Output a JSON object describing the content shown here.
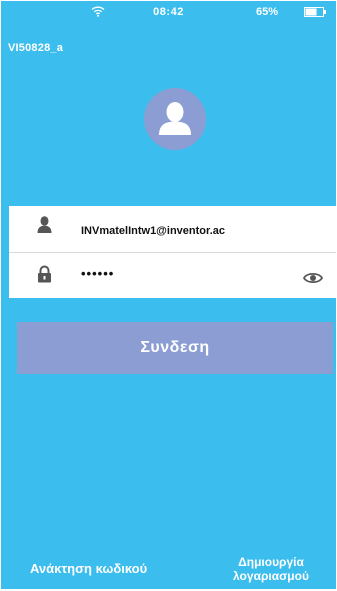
{
  "status_bar": {
    "time": "08:42",
    "battery_percent": "65%",
    "wifi_icon": "wifi-icon",
    "battery_icon": "battery-icon",
    "battery_level": 0.65
  },
  "device_id": "VI50828_a",
  "avatar_icon": "user-avatar-icon",
  "login_form": {
    "username_icon": "user-icon",
    "username_value": "INVmatelIntw1@inventor.ac",
    "password_icon": "lock-icon",
    "password_value": "••••••",
    "show_password_icon": "eye-icon"
  },
  "login_button_label": "Συνδεση",
  "forgot_password_label": "Ανάκτηση κωδικού",
  "create_account_label_line1": "Δημιουργία",
  "create_account_label_line2": "λογαριασμού",
  "colors": {
    "background": "#3bbdee",
    "accent": "#8b9dd3",
    "text": "#ffffff"
  }
}
